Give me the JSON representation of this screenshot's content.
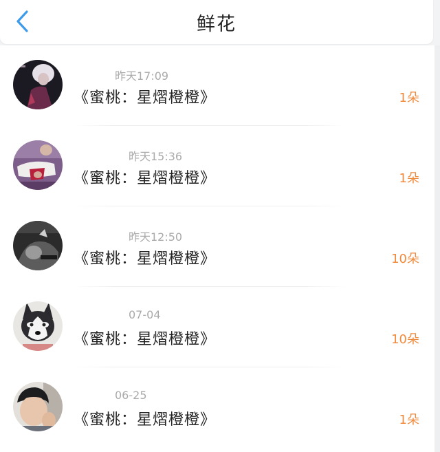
{
  "header": {
    "title": "鲜花",
    "back_icon": "chevron-left-icon",
    "accent_color": "#3d9bea"
  },
  "records": [
    {
      "time": "昨天17:09",
      "title": "《蜜桃：星熠橙橙》",
      "count": "1朵",
      "avatar": "user-avatar"
    },
    {
      "time": "昨天15:36",
      "title": "《蜜桃：星熠橙橙》",
      "count": "1朵",
      "avatar": "user-avatar"
    },
    {
      "time": "昨天12:50",
      "title": "《蜜桃：星熠橙橙》",
      "count": "10朵",
      "avatar": "user-avatar"
    },
    {
      "time": "07-04",
      "title": "《蜜桃：星熠橙橙》",
      "count": "10朵",
      "avatar": "husky-avatar"
    },
    {
      "time": "06-25",
      "title": "《蜜桃：星熠橙橙》",
      "count": "1朵",
      "avatar": "user-avatar"
    }
  ],
  "colors": {
    "count": "#f08a3c",
    "time": "#aaaaaa",
    "title": "#222222"
  }
}
